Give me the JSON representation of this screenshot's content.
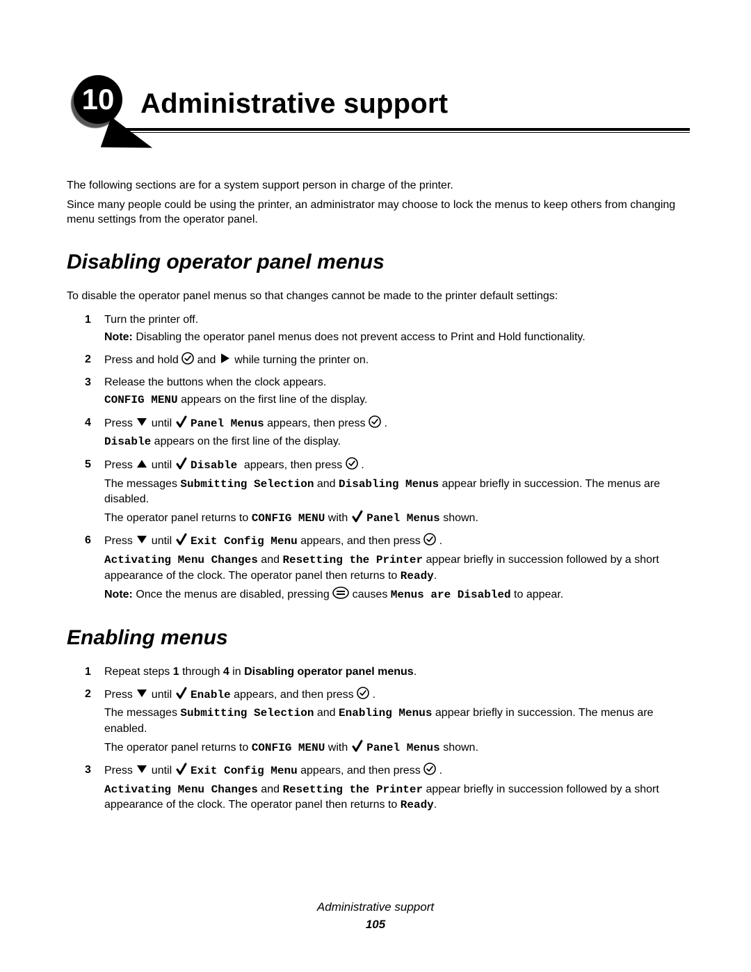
{
  "chapter": {
    "number": "10",
    "title": "Administrative support"
  },
  "intro": {
    "p1": "The following sections are for a system support person in charge of the printer.",
    "p2": "Since many people could be using the printer, an administrator may choose to lock the menus to keep others from changing menu settings from the operator panel."
  },
  "section1": {
    "heading": "Disabling operator panel menus",
    "lead": "To disable the operator panel menus so that changes cannot be made to the printer default settings:",
    "steps": {
      "s1": {
        "num": "1",
        "text": "Turn the printer off.",
        "note_label": "Note:",
        "note": " Disabling the operator panel menus does not prevent access to Print and Hold functionality."
      },
      "s2": {
        "num": "2",
        "a": "Press and hold ",
        "b": " and ",
        "c": " while turning the printer on."
      },
      "s3": {
        "num": "3",
        "a": "Release the buttons when the clock appears.",
        "code": "CONFIG MENU",
        "b": " appears on the first line of the display."
      },
      "s4": {
        "num": "4",
        "a": "Press ",
        "b": " until ",
        "code1": " Panel Menus",
        "c": " appears, then press ",
        "d": " .",
        "code2": "Disable",
        "e": " appears on the first line of the display."
      },
      "s5": {
        "num": "5",
        "a": "Press ",
        "b": "  until ",
        "code1": " Disable ",
        "c": " appears, then press ",
        "d": " .",
        "ma": "The messages ",
        "code2": "Submitting Selection",
        "mb": " and ",
        "code3": "Disabling Menus",
        "mc": " appear briefly in succession. The menus are disabled.",
        "ra": "The operator panel returns to ",
        "code4": "CONFIG MENU",
        "rb": " with ",
        "code5": " Panel Menus",
        "rc": " shown."
      },
      "s6": {
        "num": "6",
        "a": "Press ",
        "b": " until ",
        "code1": " Exit Config Menu",
        "c": " appears, and then press ",
        "d": " .",
        "code2": "Activating Menu Changes",
        "ma": " and ",
        "code3": "Resetting the Printer",
        "mb": " appear briefly in succession followed by a short appearance of the clock. The operator panel then returns to ",
        "code4": "Ready",
        "mc": ".",
        "note_label": "Note:",
        "na": " Once the menus are disabled, pressing ",
        "nb": " causes ",
        "code5": "Menus are Disabled",
        "nc": " to appear."
      }
    }
  },
  "section2": {
    "heading": "Enabling menus",
    "steps": {
      "s1": {
        "num": "1",
        "a": "Repeat steps ",
        "b1": "1",
        "b": " through ",
        "b4": "4",
        "c": " in ",
        "link": "Disabling operator panel menus",
        "d": "."
      },
      "s2": {
        "num": "2",
        "a": "Press ",
        "b": " until ",
        "code1": " Enable",
        "c": " appears, and then press ",
        "d": " .",
        "ma": "The messages ",
        "code2": "Submitting Selection",
        "mb": " and ",
        "code3": "Enabling Menus",
        "mc": " appear briefly in succession. The menus are enabled.",
        "ra": "The operator panel returns to ",
        "code4": "CONFIG MENU",
        "rb": " with ",
        "code5": " Panel Menus",
        "rc": " shown."
      },
      "s3": {
        "num": "3",
        "a": "Press ",
        "b": " until ",
        "code1": " Exit Config Menu",
        "c": " appears, and then press ",
        "d": " .",
        "code2": "Activating Menu Changes",
        "ma": " and ",
        "code3": "Resetting the Printer",
        "mb": " appear briefly in succession followed by a short appearance of the clock. The operator panel then returns to ",
        "code4": "Ready",
        "mc": "."
      }
    }
  },
  "footer": {
    "title": "Administrative support",
    "page": "105"
  }
}
